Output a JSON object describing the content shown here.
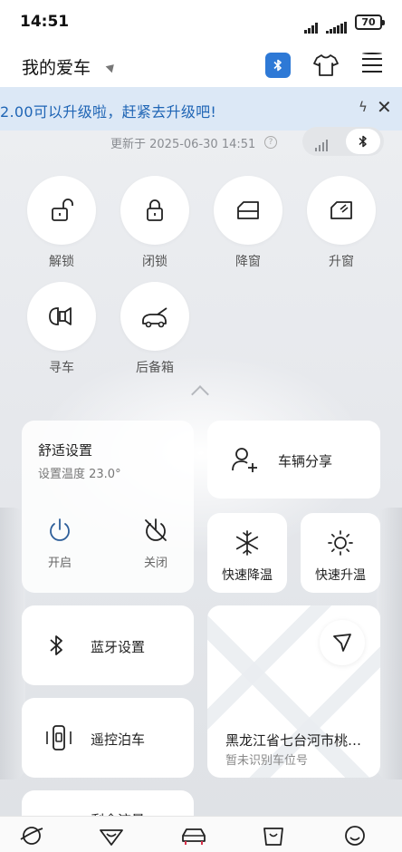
{
  "status_bar": {
    "time": "14:51",
    "battery": "70"
  },
  "header": {
    "title": "我的爱车"
  },
  "banner": {
    "text": "2.00可以升级啦，赶紧去升级吧!"
  },
  "vehicle": {
    "updated_text": "更新于 2025-06-30 14:51"
  },
  "quick_controls": [
    {
      "label": "解锁",
      "icon": "unlock-icon"
    },
    {
      "label": "闭锁",
      "icon": "lock-icon"
    },
    {
      "label": "降窗",
      "icon": "window-down-icon"
    },
    {
      "label": "升窗",
      "icon": "window-up-icon"
    },
    {
      "label": "寻车",
      "icon": "find-car-icon"
    },
    {
      "label": "后备箱",
      "icon": "trunk-icon"
    }
  ],
  "comfort": {
    "title": "舒适设置",
    "temp_text": "设置温度 23.0°",
    "on_label": "开启",
    "off_label": "关闭"
  },
  "share": {
    "label": "车辆分享"
  },
  "quick_cool": {
    "label": "快速降温"
  },
  "quick_heat": {
    "label": "快速升温"
  },
  "bluetooth_settings": {
    "label": "蓝牙设置"
  },
  "remote_parking": {
    "label": "遥控泊车"
  },
  "remaining_data": {
    "label": "剩余流量"
  },
  "location": {
    "address": "黑龙江省七台河市桃山区",
    "parking_status": "暂未识别车位号"
  },
  "bottom_nav": [
    "planet-icon",
    "heart-gift-icon",
    "car-icon",
    "shop-bag-icon",
    "profile-icon"
  ],
  "colors": {
    "accent": "#2e79d6",
    "banner_bg": "#dce8f6",
    "banner_text": "#1f65b5",
    "alert_dot": "#e0302b"
  }
}
